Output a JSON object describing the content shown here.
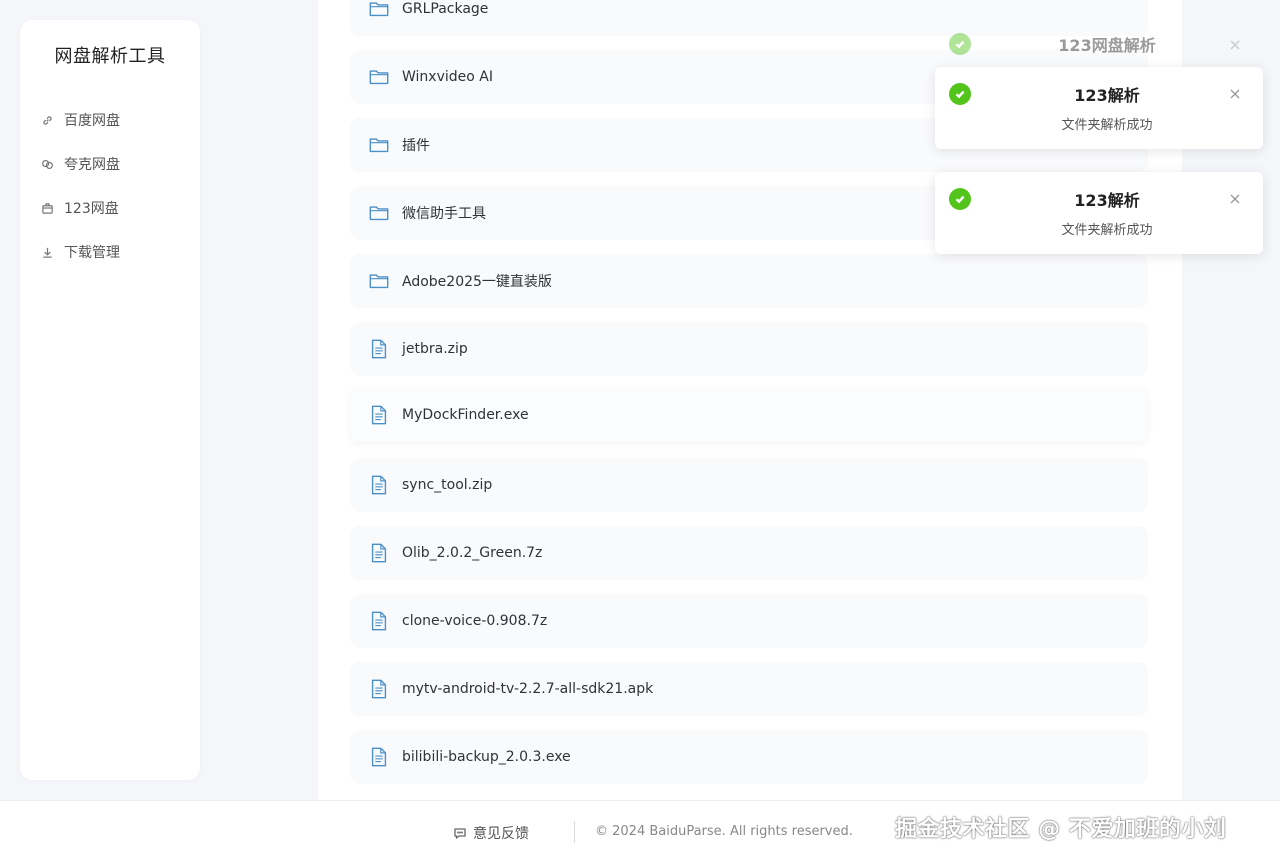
{
  "app": {
    "title": "网盘解析工具"
  },
  "sidebar": {
    "items": [
      {
        "label": "百度网盘",
        "icon": "link-icon"
      },
      {
        "label": "夸克网盘",
        "icon": "cloud-link-icon"
      },
      {
        "label": "123网盘",
        "icon": "box-icon"
      },
      {
        "label": "下载管理",
        "icon": "download-icon"
      }
    ]
  },
  "files": [
    {
      "name": "GRLPackage",
      "type": "folder"
    },
    {
      "name": "Winxvideo AI",
      "type": "folder"
    },
    {
      "name": "插件",
      "type": "folder"
    },
    {
      "name": "微信助手工具",
      "type": "folder"
    },
    {
      "name": "Adobe2025一键直装版",
      "type": "folder"
    },
    {
      "name": "jetbra.zip",
      "type": "file"
    },
    {
      "name": "MyDockFinder.exe",
      "type": "file"
    },
    {
      "name": "sync_tool.zip",
      "type": "file"
    },
    {
      "name": "Olib_2.0.2_Green.7z",
      "type": "file"
    },
    {
      "name": "clone-voice-0.908.7z",
      "type": "file"
    },
    {
      "name": "mytv-android-tv-2.2.7-all-sdk21.apk",
      "type": "file"
    },
    {
      "name": "bilibili-backup_2.0.3.exe",
      "type": "file"
    }
  ],
  "notifications": [
    {
      "title": "123网盘解析",
      "message": "",
      "state": "fading"
    },
    {
      "title": "123解析",
      "message": "文件夹解析成功",
      "state": "visible"
    },
    {
      "title": "123解析",
      "message": "文件夹解析成功",
      "state": "visible"
    }
  ],
  "footer": {
    "feedback": "意见反馈",
    "copyright": "© 2024 BaiduParse. All rights reserved.",
    "watermark": "掘金技术社区 @ 不爱加班的小刘"
  },
  "colors": {
    "success": "#52c41a",
    "folder_icon": "#4a90c8",
    "background": "#f4f6f9"
  }
}
